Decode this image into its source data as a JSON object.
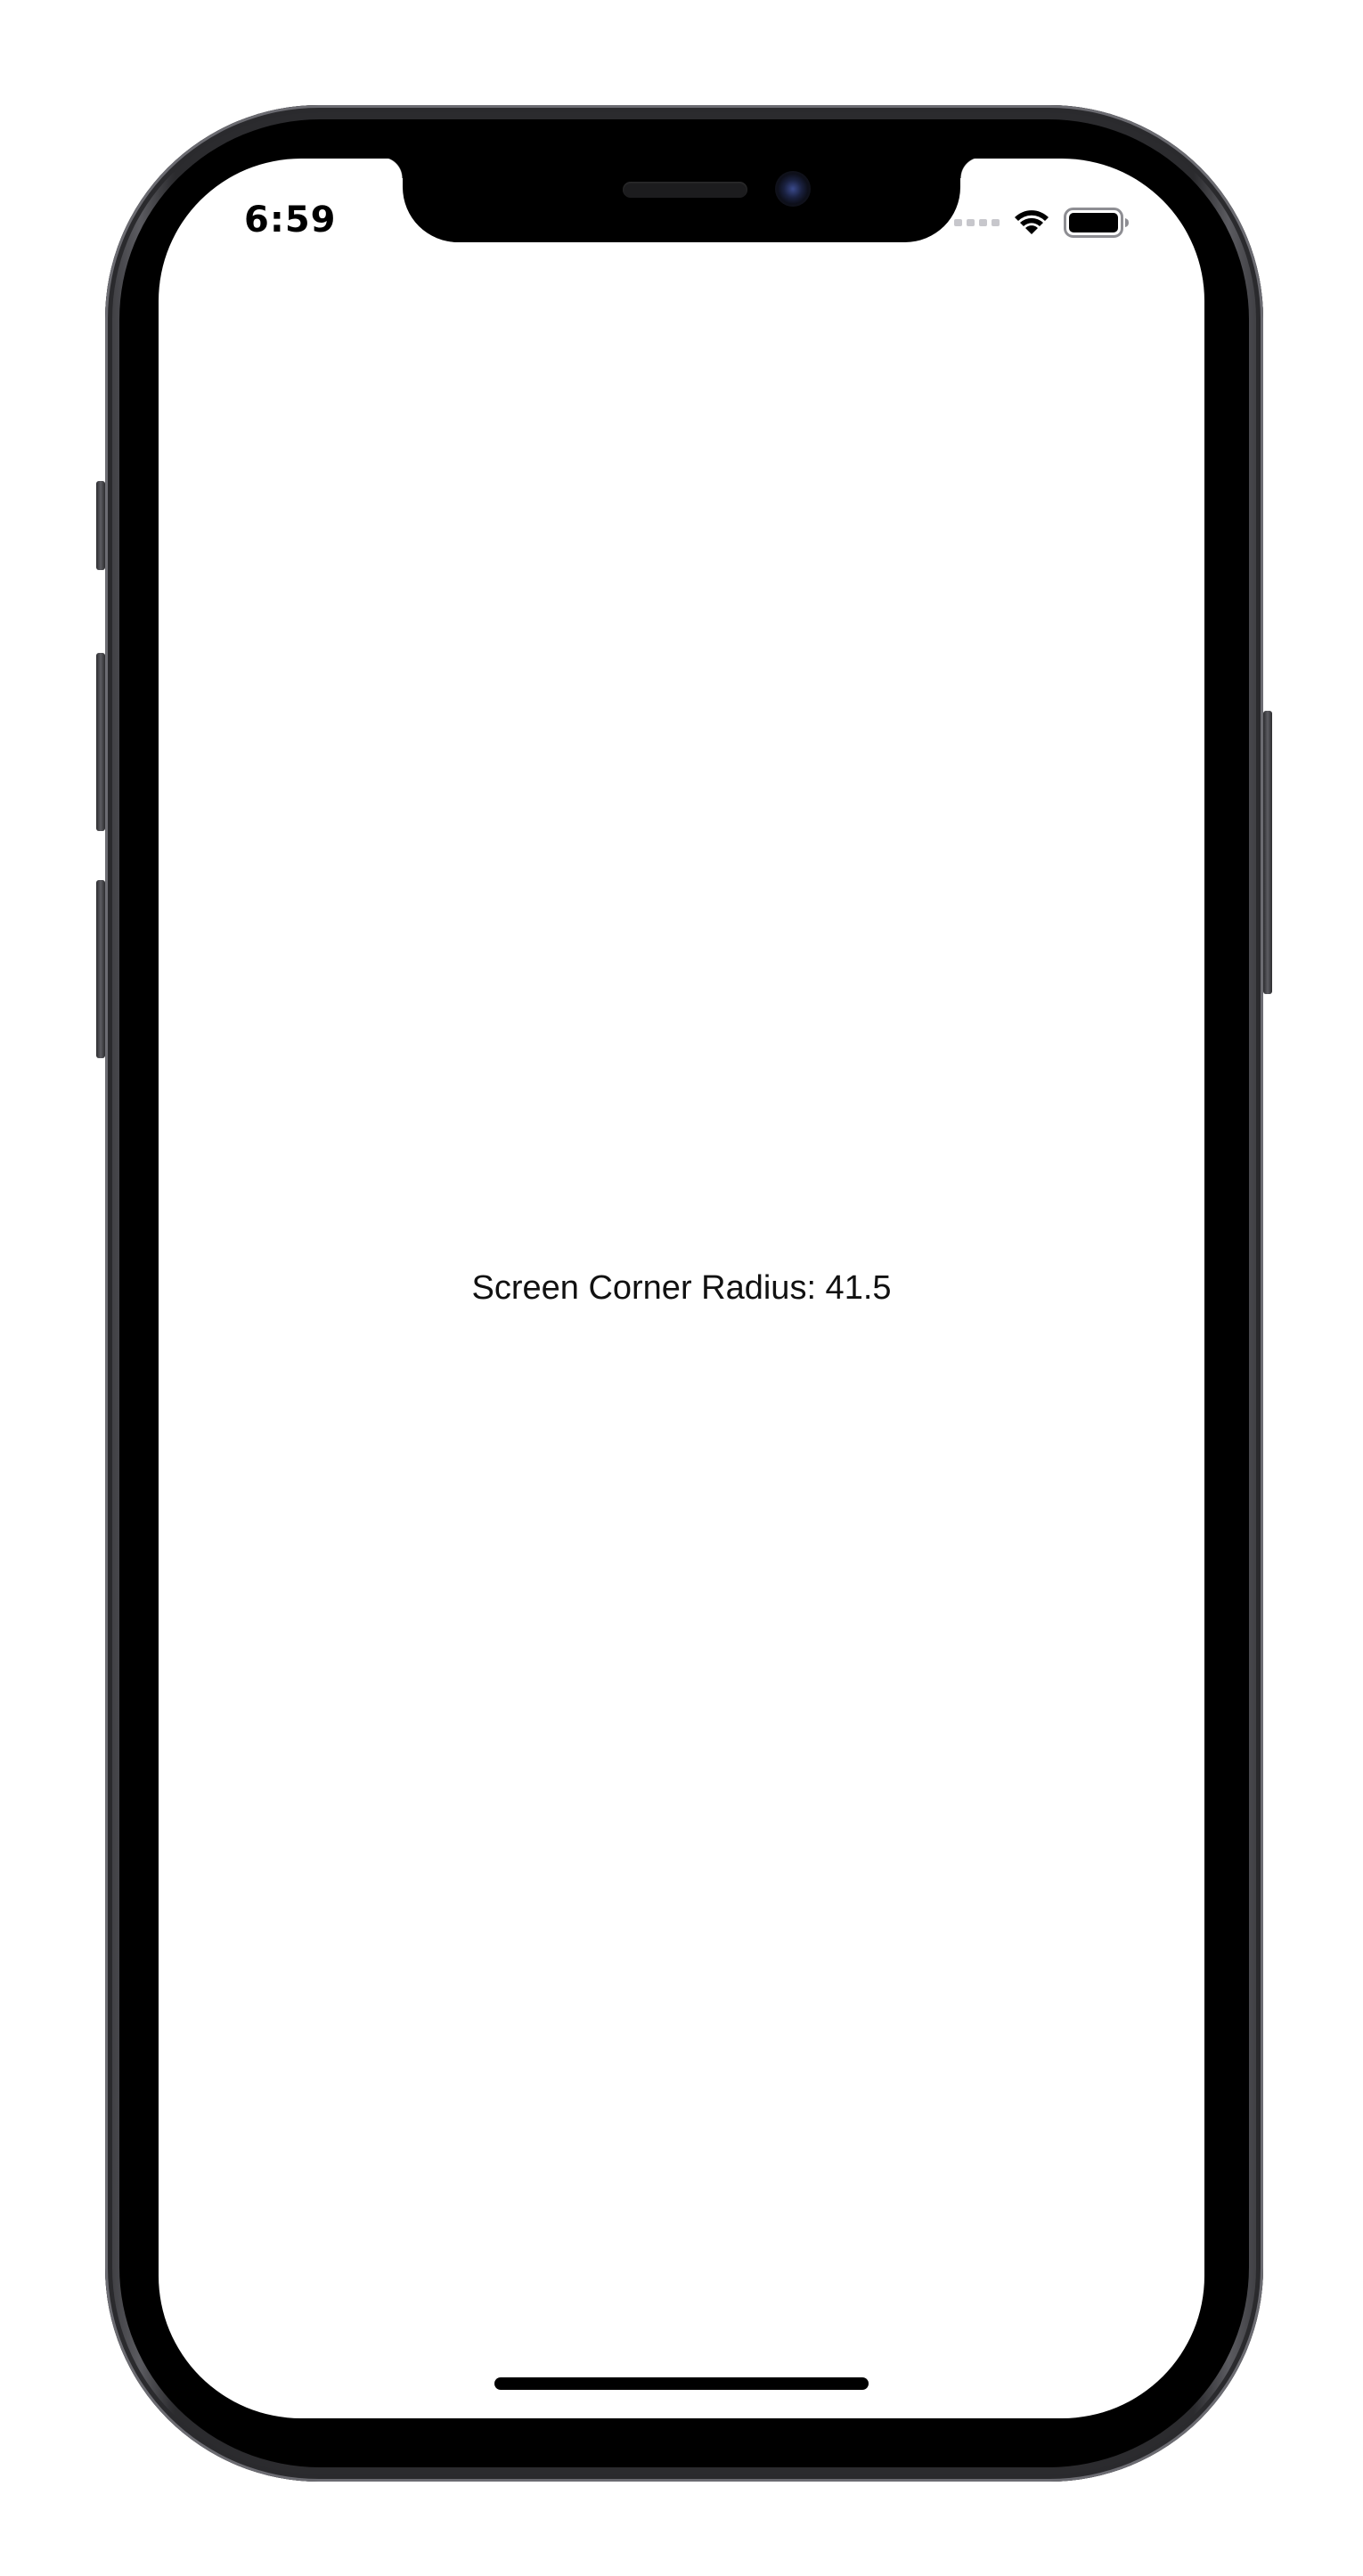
{
  "status_bar": {
    "time": "6:59",
    "signal_icon": "cellular-signal-icon",
    "wifi_icon": "wifi-icon",
    "battery_icon": "battery-icon"
  },
  "main": {
    "label": "Screen Corner Radius: 41.5"
  },
  "colors": {
    "screen_background": "#ffffff",
    "text": "#111111",
    "frame": "#2b2b2e"
  }
}
